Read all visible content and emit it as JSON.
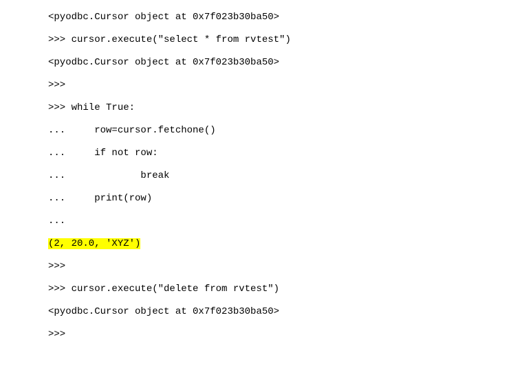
{
  "lines": [
    {
      "text": "<pyodbc.Cursor object at 0x7f023b30ba50>",
      "hl": false
    },
    {
      "text": ">>> cursor.execute(\"select * from rvtest\")",
      "hl": false
    },
    {
      "text": "<pyodbc.Cursor object at 0x7f023b30ba50>",
      "hl": false
    },
    {
      "text": ">>>",
      "hl": false
    },
    {
      "text": ">>> while True:",
      "hl": false
    },
    {
      "text": "...     row=cursor.fetchone()",
      "hl": false
    },
    {
      "text": "...     if not row:",
      "hl": false
    },
    {
      "text": "...             break",
      "hl": false
    },
    {
      "text": "...     print(row)",
      "hl": false
    },
    {
      "text": "...",
      "hl": false
    },
    {
      "text": "(2, 20.0, 'XYZ')",
      "hl": true
    },
    {
      "text": ">>>",
      "hl": false
    },
    {
      "text": ">>> cursor.execute(\"delete from rvtest\")",
      "hl": false
    },
    {
      "text": "<pyodbc.Cursor object at 0x7f023b30ba50>",
      "hl": false
    },
    {
      "text": ">>>",
      "hl": false
    }
  ]
}
